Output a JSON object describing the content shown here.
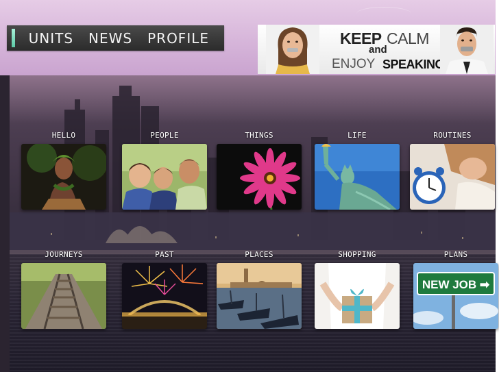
{
  "nav": {
    "items": [
      {
        "label": "UNITS"
      },
      {
        "label": "NEWS"
      },
      {
        "label": "PROFILE"
      }
    ]
  },
  "banner": {
    "keep": "KEEP",
    "calm": "CALM",
    "and": "and",
    "enjoy": "ENJOY",
    "speaking": "SPEAKING"
  },
  "tiles": [
    {
      "label": "HELLO"
    },
    {
      "label": "PEOPLE"
    },
    {
      "label": "THINGS"
    },
    {
      "label": "LIFE"
    },
    {
      "label": "ROUTINES"
    },
    {
      "label": "JOURNEYS"
    },
    {
      "label": "PAST"
    },
    {
      "label": "PLACES"
    },
    {
      "label": "SHOPPING"
    },
    {
      "label": "PLANS"
    }
  ],
  "plans_sign": "NEW JOB ➡",
  "colors": {
    "nav_accent": "#5cc9a6",
    "nav_bg": "#2b2b2b",
    "panel": "#3a3040",
    "top_strip": "#d9b9dc"
  }
}
